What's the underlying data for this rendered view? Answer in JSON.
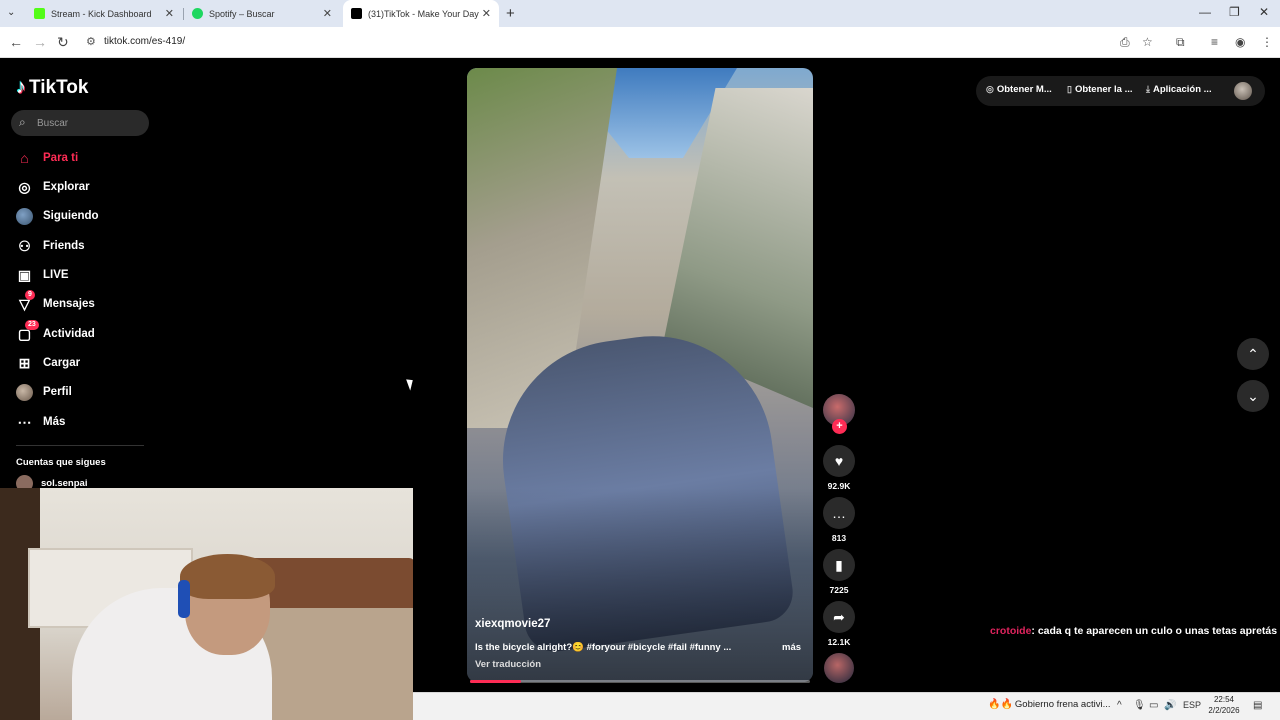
{
  "browser": {
    "tabs": [
      {
        "title": "Stream - Kick Dashboard",
        "favicon_color": "#53fc18"
      },
      {
        "title": "Spotify – Buscar",
        "favicon_color": "#1ed760"
      },
      {
        "title": "(31)TikTok - Make Your Day",
        "favicon_color": "#000000"
      }
    ],
    "url": "tiktok.com/es-419/"
  },
  "tiktok": {
    "logo_text": "TikTok",
    "search_placeholder": "Buscar",
    "nav": [
      {
        "label": "Para ti",
        "icon": "home-icon",
        "active": true
      },
      {
        "label": "Explorar",
        "icon": "compass-icon"
      },
      {
        "label": "Siguiendo",
        "icon": "following-avatar-icon"
      },
      {
        "label": "Friends",
        "icon": "friends-icon"
      },
      {
        "label": "LIVE",
        "icon": "live-icon"
      },
      {
        "label": "Mensajes",
        "icon": "messages-icon",
        "badge": "9"
      },
      {
        "label": "Actividad",
        "icon": "activity-icon",
        "badge": "23"
      },
      {
        "label": "Cargar",
        "icon": "upload-icon"
      },
      {
        "label": "Perfil",
        "icon": "profile-avatar-icon"
      },
      {
        "label": "Más",
        "icon": "more-icon"
      }
    ],
    "following_title": "Cuentas que sigues",
    "following": [
      {
        "name": "sol.senpai"
      }
    ],
    "top_pills": [
      {
        "label": "Obtener M...",
        "icon": "coin-icon"
      },
      {
        "label": "Obtener la ...",
        "icon": "phone-icon"
      },
      {
        "label": "Aplicación ...",
        "icon": "download-icon"
      }
    ],
    "video": {
      "author": "xiexqmovie27",
      "caption": "Is the bicycle alright?😊 #foryour #bicycle #fail #funny ...",
      "more_label": "más",
      "translate_label": "Ver traducción",
      "progress": 0.15
    },
    "actions": {
      "likes": "92.9K",
      "comments": "813",
      "saves": "7225",
      "shares": "12.1K"
    }
  },
  "chat": {
    "user": "crotoide",
    "message": ": cada q te aparecen un culo o unas tetas apretás F5"
  },
  "taskbar": {
    "news": "Gobierno frena activi...",
    "language": "ESP",
    "time": "22:54",
    "date": "2/2/2026"
  },
  "colors": {
    "accent": "#fe2c55",
    "background": "#000000"
  }
}
